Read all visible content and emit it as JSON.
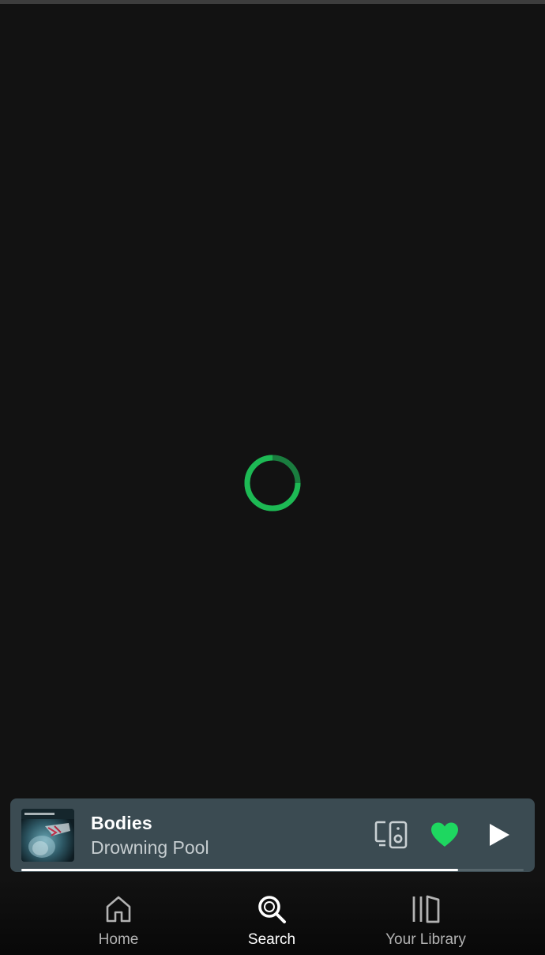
{
  "colors": {
    "background": "#121212",
    "accent": "#1ed760",
    "spinner": "#1db954",
    "mini_player_bg": "#3b4b52",
    "inactive_text": "#b3b3b3",
    "active_text": "#ffffff"
  },
  "loading": {
    "spinner_icon": "loading-spinner"
  },
  "now_playing": {
    "title": "Bodies",
    "artist": "Drowning Pool",
    "album_art_icon": "album-cover",
    "device_icon": "connect-device-icon",
    "liked": true,
    "like_icon": "heart-filled-icon",
    "play_icon": "play-icon",
    "progress": 0.87
  },
  "nav": {
    "items": [
      {
        "label": "Home",
        "icon": "home-icon",
        "active": false
      },
      {
        "label": "Search",
        "icon": "search-icon",
        "active": true
      },
      {
        "label": "Your Library",
        "icon": "library-icon",
        "active": false
      }
    ]
  }
}
